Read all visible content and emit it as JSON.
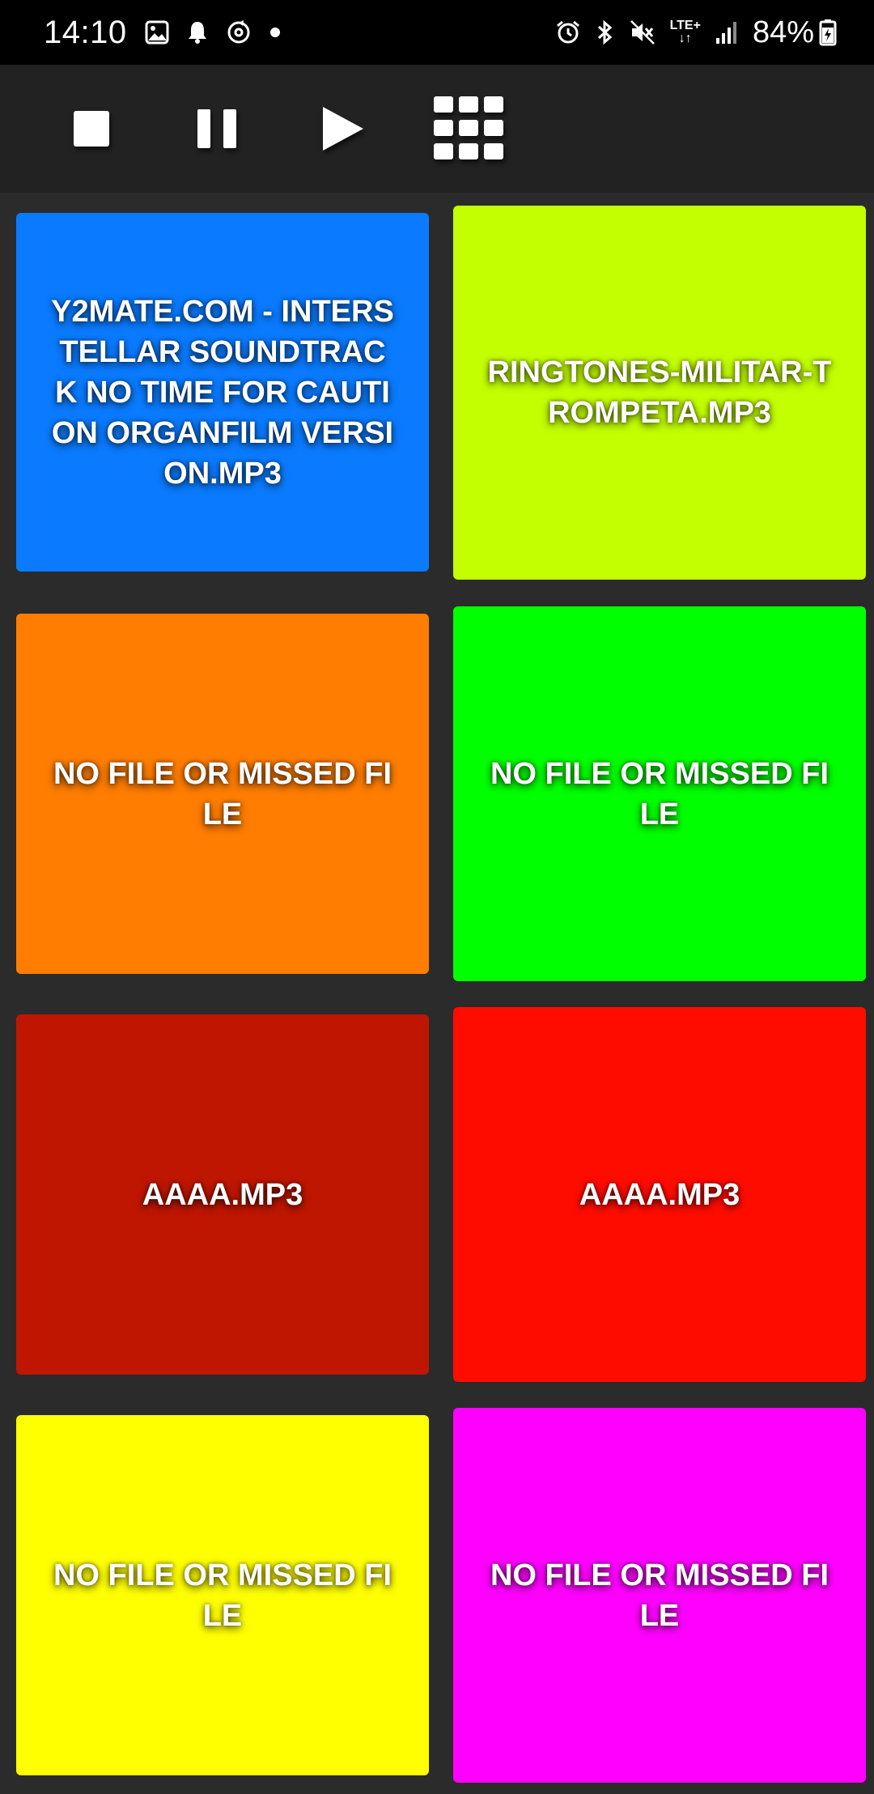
{
  "status_bar": {
    "time": "14:10",
    "network": "LTE+",
    "battery": "84%",
    "icons": [
      "gallery-icon",
      "bell-icon",
      "sync-icon",
      "dot-icon",
      "alarm-icon",
      "bluetooth-icon",
      "mute-icon",
      "signal-icon",
      "battery-icon"
    ]
  },
  "toolbar": {
    "buttons": [
      "stop-icon",
      "pause-icon",
      "play-icon",
      "grid-icon"
    ]
  },
  "pads": [
    {
      "label": "Y2MATE.COM - INTERSTELLAR SOUNDTRACK  NO TIME FOR CAUTION ORGANFILM VERSION.MP3",
      "color": "#0a7bff"
    },
    {
      "label": "RINGTONES-MILITAR-TROMPETA.MP3",
      "color": "#c3ff00"
    },
    {
      "label": "NO FILE OR MISSED FILE",
      "color": "#ff7d00"
    },
    {
      "label": "NO FILE OR MISSED FILE",
      "color": "#00ff00"
    },
    {
      "label": "AAAA.MP3",
      "color": "#be1600"
    },
    {
      "label": "AAAA.MP3",
      "color": "#ff0c00"
    },
    {
      "label": "NO FILE OR MISSED FILE",
      "color": "#ffff00"
    },
    {
      "label": "NO FILE OR MISSED FILE",
      "color": "#ff00ff"
    }
  ]
}
